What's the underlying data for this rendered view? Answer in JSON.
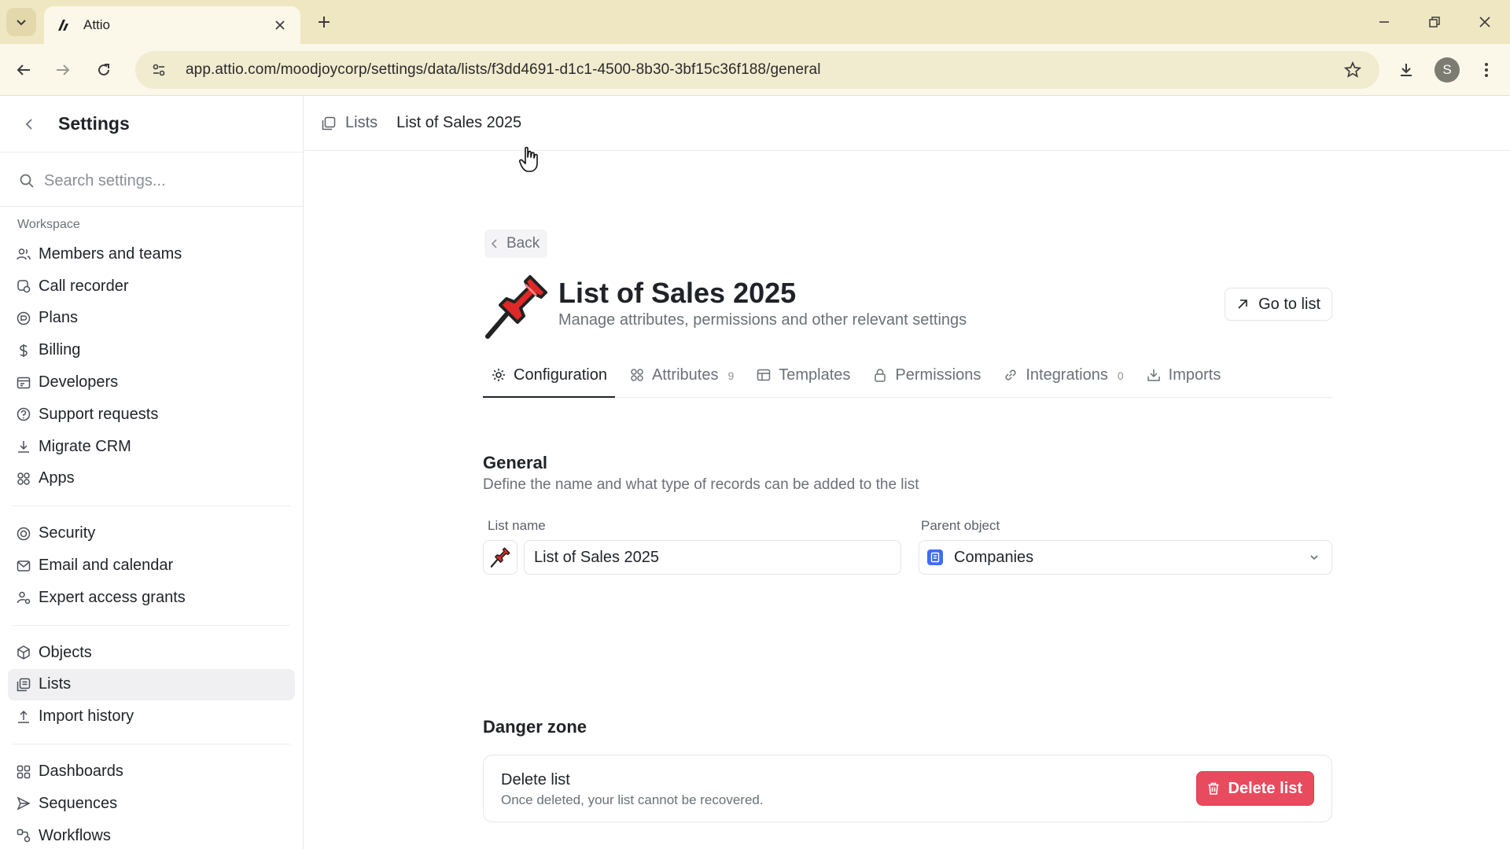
{
  "browser": {
    "tab_title": "Attio",
    "url": "app.attio.com/moodjoycorp/settings/data/lists/f3dd4691-d1c1-4500-8b30-3bf15c36f188/general",
    "profile_initial": "S"
  },
  "sidebar": {
    "title": "Settings",
    "search_placeholder": "Search settings...",
    "workspace_label": "Workspace",
    "groups": [
      [
        {
          "label": "Members and teams",
          "icon": "people-icon"
        },
        {
          "label": "Call recorder",
          "icon": "call-recorder-icon"
        },
        {
          "label": "Plans",
          "icon": "plans-icon"
        },
        {
          "label": "Billing",
          "icon": "dollar-icon"
        },
        {
          "label": "Developers",
          "icon": "developers-icon"
        },
        {
          "label": "Support requests",
          "icon": "help-icon"
        },
        {
          "label": "Migrate CRM",
          "icon": "download-icon"
        },
        {
          "label": "Apps",
          "icon": "apps-icon"
        }
      ],
      [
        {
          "label": "Security",
          "icon": "security-icon"
        },
        {
          "label": "Email and calendar",
          "icon": "mail-icon"
        },
        {
          "label": "Expert access grants",
          "icon": "expert-access-icon"
        }
      ],
      [
        {
          "label": "Objects",
          "icon": "cube-icon"
        },
        {
          "label": "Lists",
          "icon": "lists-icon"
        },
        {
          "label": "Import history",
          "icon": "upload-icon"
        }
      ],
      [
        {
          "label": "Dashboards",
          "icon": "dashboard-icon"
        },
        {
          "label": "Sequences",
          "icon": "send-icon"
        },
        {
          "label": "Workflows",
          "icon": "workflow-icon"
        }
      ]
    ]
  },
  "breadcrumb": {
    "parent": "Lists",
    "current": "List of Sales 2025"
  },
  "page": {
    "back_label": "Back",
    "title": "List of Sales 2025",
    "subtitle": "Manage attributes, permissions and other relevant settings",
    "goto_label": "Go to list",
    "tabs": [
      {
        "label": "Configuration",
        "count": "",
        "icon": "gear-icon"
      },
      {
        "label": "Attributes",
        "count": "9",
        "icon": "attributes-icon"
      },
      {
        "label": "Templates",
        "count": "",
        "icon": "templates-icon"
      },
      {
        "label": "Permissions",
        "count": "",
        "icon": "lock-icon"
      },
      {
        "label": "Integrations",
        "count": "0",
        "icon": "link-icon"
      },
      {
        "label": "Imports",
        "count": "",
        "icon": "import-icon"
      }
    ],
    "general": {
      "title": "General",
      "subtitle": "Define the name and what type of records can be added to the list",
      "list_name_label": "List name",
      "list_name_value": "List of Sales 2025",
      "parent_object_label": "Parent object",
      "parent_object_value": "Companies"
    },
    "danger": {
      "title": "Danger zone",
      "card_title": "Delete list",
      "card_subtitle": "Once deleted, your list cannot be recovered.",
      "delete_label": "Delete list"
    }
  },
  "colors": {
    "danger": "#e94b5e",
    "object_icon": "#3f6cf0",
    "chrome": "#efe7c2"
  }
}
